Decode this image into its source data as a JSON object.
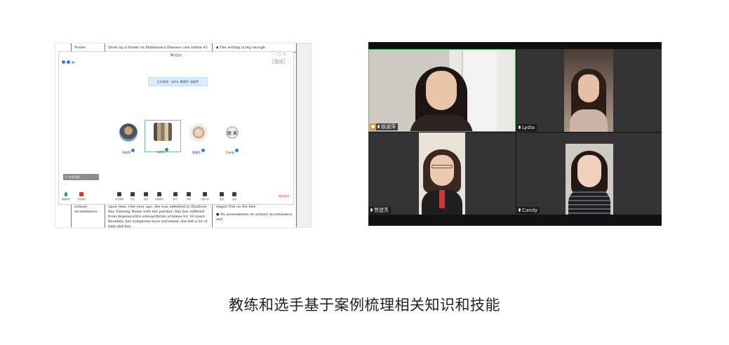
{
  "document": {
    "top_row": {
      "col1": "Poster",
      "col2": "Draw up a Poster on Parkinson's Disease care within 45",
      "col3": "The writing is big enough"
    },
    "bottom_row": {
      "col1": "urinary incontinence",
      "col2": "upon time. One year ago, she was admitted to Rainbow Bay Nursing Home with her partner. She has suffered from degenerative osteoarthritis of knees for 10 years. Recently, her symptoms have worsened, she felt a lot of pain and has",
      "col3_a": "diaper Pad on the bed.",
      "col3_b": "Do assessments on urinary incontinence and"
    }
  },
  "meeting_app": {
    "window_title": "腾讯会议",
    "speaking_banner": "正在讲话：Lydia; 贾建芳; 张丽芹",
    "right_button": "Social",
    "participants": [
      {
        "name": "徐淑萍"
      },
      {
        "name": "Lydia"
      },
      {
        "name": "贾建芳"
      },
      {
        "name": "Candy"
      }
    ],
    "avatar_text": "龍 果",
    "control_pill": "共享屏幕...",
    "toolbar": [
      {
        "label": "解除静音",
        "icon": "mic-icon"
      },
      {
        "label": "开启视频",
        "icon": "video-icon"
      },
      {
        "label": "共享屏幕",
        "icon": "share-screen-icon"
      },
      {
        "label": "安全",
        "icon": "shield-icon"
      },
      {
        "label": "邀请",
        "icon": "invite-icon"
      },
      {
        "label": "管理成员",
        "icon": "members-icon"
      },
      {
        "label": "聊天",
        "icon": "chat-icon"
      },
      {
        "label": "录制",
        "icon": "record-icon"
      },
      {
        "label": "分组讨论",
        "icon": "breakout-icon"
      },
      {
        "label": "应用",
        "icon": "apps-icon"
      },
      {
        "label": "设置",
        "icon": "gear-icon"
      }
    ],
    "leave_button": "结束会议"
  },
  "video_call": {
    "tiles": [
      {
        "name": "徐淑萍",
        "host": true
      },
      {
        "name": "Lydia",
        "host": false
      },
      {
        "name": "贾建芳",
        "host": false
      },
      {
        "name": "Candy",
        "host": false
      }
    ]
  },
  "caption": "教练和选手基于案例梳理相关知识和技能"
}
